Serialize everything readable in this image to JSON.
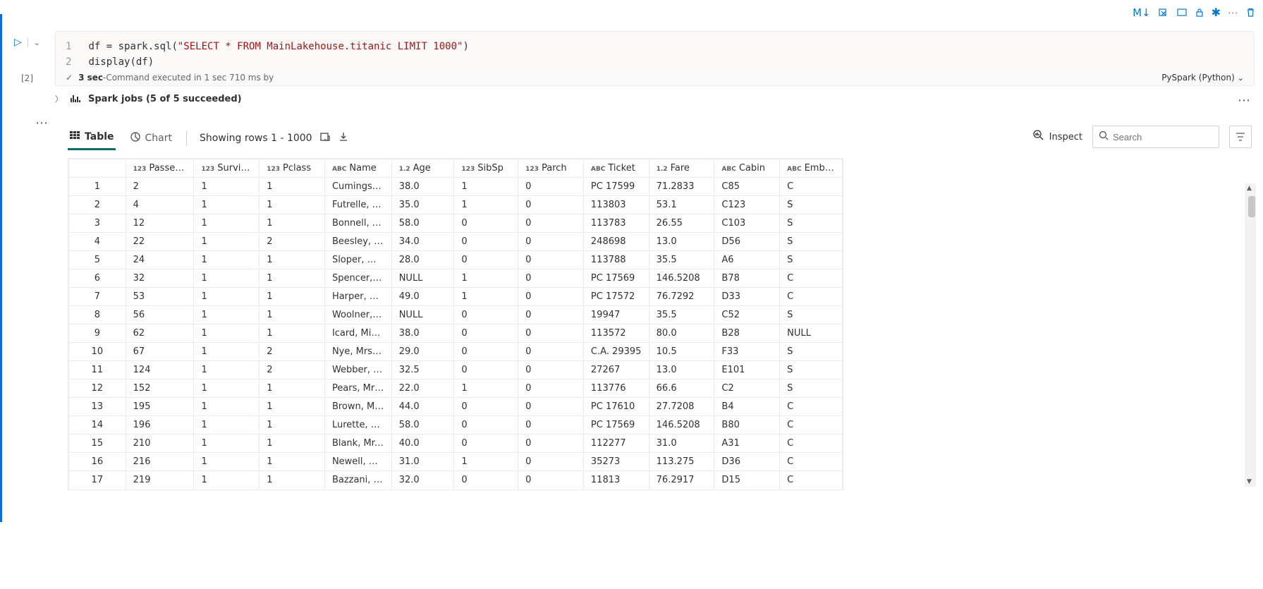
{
  "ribbon_actions": [
    "M↓",
    "⎘",
    "⎚",
    "🔒",
    "✱",
    "⋯",
    "🗑"
  ],
  "cell": {
    "index_label": "[2]",
    "code_line1_pre": "df = spark.sql(",
    "code_line1_str": "\"SELECT * FROM MainLakehouse.titanic LIMIT 1000\"",
    "code_line1_post": ")",
    "code_line2": "display(df)"
  },
  "status": {
    "check": "✓",
    "duration": "3 sec",
    "info": " -Command executed in 1 sec 710 ms by",
    "language": "PySpark (Python)"
  },
  "spark_jobs": "Spark jobs (5 of 5 succeeded)",
  "tabs": {
    "table": "Table",
    "chart": "Chart"
  },
  "row_info": "Showing rows 1 - 1000",
  "inspect": "Inspect",
  "search_placeholder": "Search",
  "columns": [
    {
      "type": "123",
      "label": "Passenger..."
    },
    {
      "type": "123",
      "label": "Survived"
    },
    {
      "type": "123",
      "label": "Pclass"
    },
    {
      "type": "ABC",
      "label": "Name"
    },
    {
      "type": "1.2",
      "label": "Age"
    },
    {
      "type": "123",
      "label": "SibSp"
    },
    {
      "type": "123",
      "label": "Parch"
    },
    {
      "type": "ABC",
      "label": "Ticket"
    },
    {
      "type": "1.2",
      "label": "Fare"
    },
    {
      "type": "ABC",
      "label": "Cabin"
    },
    {
      "type": "ABC",
      "label": "Embarked"
    }
  ],
  "rows": [
    {
      "n": "1",
      "c": [
        "2",
        "1",
        "1",
        "Cumings, M...",
        "38.0",
        "1",
        "0",
        "PC 17599",
        "71.2833",
        "C85",
        "C"
      ]
    },
    {
      "n": "2",
      "c": [
        "4",
        "1",
        "1",
        "Futrelle, Mrs...",
        "35.0",
        "1",
        "0",
        "113803",
        "53.1",
        "C123",
        "S"
      ]
    },
    {
      "n": "3",
      "c": [
        "12",
        "1",
        "1",
        "Bonnell, Mis...",
        "58.0",
        "0",
        "0",
        "113783",
        "26.55",
        "C103",
        "S"
      ]
    },
    {
      "n": "4",
      "c": [
        "22",
        "1",
        "2",
        "Beesley, Mr....",
        "34.0",
        "0",
        "0",
        "248698",
        "13.0",
        "D56",
        "S"
      ]
    },
    {
      "n": "5",
      "c": [
        "24",
        "1",
        "1",
        "Sloper, Mr. ...",
        "28.0",
        "0",
        "0",
        "113788",
        "35.5",
        "A6",
        "S"
      ]
    },
    {
      "n": "6",
      "c": [
        "32",
        "1",
        "1",
        "Spencer, Mr...",
        "NULL",
        "1",
        "0",
        "PC 17569",
        "146.5208",
        "B78",
        "C"
      ]
    },
    {
      "n": "7",
      "c": [
        "53",
        "1",
        "1",
        "Harper, Mrs....",
        "49.0",
        "1",
        "0",
        "PC 17572",
        "76.7292",
        "D33",
        "C"
      ]
    },
    {
      "n": "8",
      "c": [
        "56",
        "1",
        "1",
        "Woolner, M...",
        "NULL",
        "0",
        "0",
        "19947",
        "35.5",
        "C52",
        "S"
      ]
    },
    {
      "n": "9",
      "c": [
        "62",
        "1",
        "1",
        "Icard, Miss. ...",
        "38.0",
        "0",
        "0",
        "113572",
        "80.0",
        "B28",
        "NULL"
      ]
    },
    {
      "n": "10",
      "c": [
        "67",
        "1",
        "2",
        "Nye, Mrs. (E...",
        "29.0",
        "0",
        "0",
        "C.A. 29395",
        "10.5",
        "F33",
        "S"
      ]
    },
    {
      "n": "11",
      "c": [
        "124",
        "1",
        "2",
        "Webber, Mi...",
        "32.5",
        "0",
        "0",
        "27267",
        "13.0",
        "E101",
        "S"
      ]
    },
    {
      "n": "12",
      "c": [
        "152",
        "1",
        "1",
        "Pears, Mrs. ...",
        "22.0",
        "1",
        "0",
        "113776",
        "66.6",
        "C2",
        "S"
      ]
    },
    {
      "n": "13",
      "c": [
        "195",
        "1",
        "1",
        "Brown, Mrs. ...",
        "44.0",
        "0",
        "0",
        "PC 17610",
        "27.7208",
        "B4",
        "C"
      ]
    },
    {
      "n": "14",
      "c": [
        "196",
        "1",
        "1",
        "Lurette, Mis...",
        "58.0",
        "0",
        "0",
        "PC 17569",
        "146.5208",
        "B80",
        "C"
      ]
    },
    {
      "n": "15",
      "c": [
        "210",
        "1",
        "1",
        "Blank, Mr. H...",
        "40.0",
        "0",
        "0",
        "112277",
        "31.0",
        "A31",
        "C"
      ]
    },
    {
      "n": "16",
      "c": [
        "216",
        "1",
        "1",
        "Newell, Mis...",
        "31.0",
        "1",
        "0",
        "35273",
        "113.275",
        "D36",
        "C"
      ]
    },
    {
      "n": "17",
      "c": [
        "219",
        "1",
        "1",
        "Bazzani, Mis...",
        "32.0",
        "0",
        "0",
        "11813",
        "76.2917",
        "D15",
        "C"
      ]
    }
  ]
}
